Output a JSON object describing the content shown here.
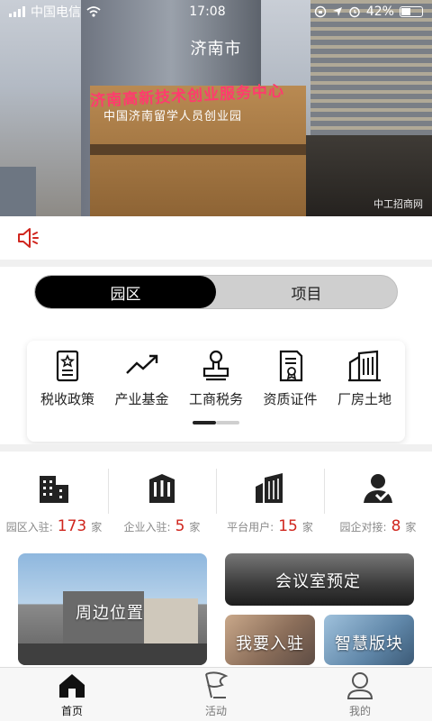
{
  "status_bar": {
    "carrier": "中国电信",
    "time": "17:08",
    "battery": "42%"
  },
  "hero": {
    "city": "济南市",
    "sign_main": "济南高新技术创业服务中心",
    "sign_sub": "中国济南留学人员创业园",
    "watermark": "中工招商网"
  },
  "notice": {
    "icon": "speaker-icon"
  },
  "toggle": {
    "tabs": [
      {
        "label": "园区"
      },
      {
        "label": "项目"
      }
    ],
    "active_index": 0
  },
  "categories": [
    {
      "label": "税收政策",
      "icon": "policy-document-icon"
    },
    {
      "label": "产业基金",
      "icon": "trend-up-icon"
    },
    {
      "label": "工商税务",
      "icon": "stamp-icon"
    },
    {
      "label": "资质证件",
      "icon": "certificate-icon"
    },
    {
      "label": "厂房土地",
      "icon": "factory-building-icon"
    }
  ],
  "stats": [
    {
      "label": "园区入驻:",
      "value": "173",
      "unit": "家",
      "icon": "park-building-icon"
    },
    {
      "label": "企业入驻:",
      "value": "5",
      "unit": "家",
      "icon": "enterprise-building-icon"
    },
    {
      "label": "平台用户:",
      "value": "15",
      "unit": "家",
      "icon": "platform-building-icon"
    },
    {
      "label": "园企对接:",
      "value": "8",
      "unit": "家",
      "icon": "handshake-user-icon"
    }
  ],
  "tiles": {
    "nearby": "周边位置",
    "meeting": "会议室预定",
    "join": "我要入驻",
    "smart": "智慧版块"
  },
  "tabbar": [
    {
      "label": "首页",
      "icon": "home-icon",
      "active": true
    },
    {
      "label": "活动",
      "icon": "activity-flag-icon",
      "active": false
    },
    {
      "label": "我的",
      "icon": "user-profile-icon",
      "active": false
    }
  ],
  "colors": {
    "accent_red": "#d0261e",
    "toggle_active": "#000000",
    "toggle_bg": "#cfcfcf"
  }
}
